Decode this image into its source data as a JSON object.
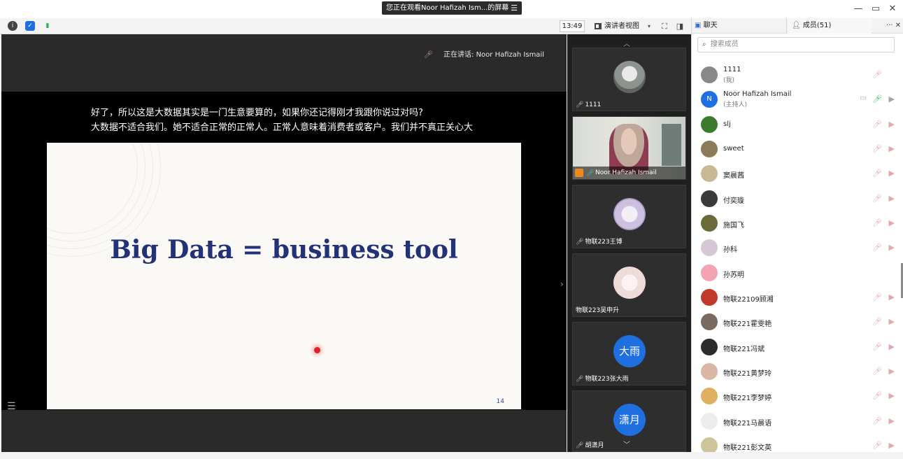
{
  "window": {
    "share_banner": "您正在观看Noor Hafizah Ism...的屏幕",
    "share_banner_menu": "☰",
    "minimize": "—",
    "restore": "▭",
    "close": "✕"
  },
  "toolbar": {
    "time": "13:49",
    "view_mode": "演讲者视图",
    "caret": "▾",
    "fullscreen": "⛶",
    "layout": "◨",
    "icon_colors": {
      "info": "#444444",
      "shield": "#1e6fe0",
      "signal": "#2fae58"
    }
  },
  "stage": {
    "speaking_label": "正在讲话: Noor Hafizah Ismail",
    "subtitle_line1": "好了，所以这是大数据其实是一门生意要算的，如果你还记得刚才我跟你说过对吗?",
    "subtitle_line2": "大数据不适合我们。她不适合正常的正常人。正常人意味着消费者或客户。我们并不真正关心大",
    "slide_title": "Big Data = business tool",
    "slide_page": "14",
    "slide_title_color": "#233277"
  },
  "video_strip": {
    "tiles": [
      {
        "name": "1111"
      },
      {
        "name": "Noor Hafizah Ismail"
      },
      {
        "name": "物联223王博"
      },
      {
        "name": "物联223吴申升"
      },
      {
        "name": "物联223张大雨",
        "avatar_text": "大雨"
      },
      {
        "name": "胡潇月",
        "avatar_text": "潇月"
      }
    ]
  },
  "panel": {
    "tab_chat": "聊天",
    "tab_members": "成员(51)",
    "tab_controls": "··· ✕",
    "search_placeholder": "搜索成员",
    "members": [
      {
        "name": "1111",
        "sub": "(我)"
      },
      {
        "name": "Noor Hafizah Ismail",
        "sub": "(主持人)",
        "avatar_text": "N"
      },
      {
        "name": "slj"
      },
      {
        "name": "sweet"
      },
      {
        "name": "窦晨茜"
      },
      {
        "name": "付奕璇"
      },
      {
        "name": "施国飞"
      },
      {
        "name": "孙科"
      },
      {
        "name": "孙苏明"
      },
      {
        "name": "物联22109顾湘"
      },
      {
        "name": "物联221霍雯艳"
      },
      {
        "name": "物联221冯斌"
      },
      {
        "name": "物联221黄梦玲"
      },
      {
        "name": "物联221李梦婷"
      },
      {
        "name": "物联221马晨语"
      },
      {
        "name": "物联221彭文英"
      }
    ]
  }
}
